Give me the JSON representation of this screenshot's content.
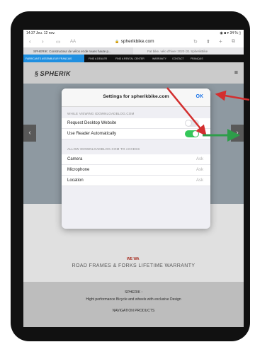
{
  "status": {
    "time": "14:37  Jeu. 12 nov.",
    "indicators": "◉ ■ ▾ 34 % ▯"
  },
  "urlbar": {
    "back": "‹",
    "forward": "›",
    "book": "▭",
    "aa": "AA",
    "domain": "spherikbike.com",
    "reload": "↻",
    "share": "⬆",
    "add": "+",
    "tabs": "⧉"
  },
  "tabs": [
    {
      "label": "SPHERIK: Constructeur de vélos et de roues haute p..."
    },
    {
      "label": "Fat bike, vélo d'hiver 2020 /21 SpherikBike"
    }
  ],
  "nav": [
    "FABRICANTS ASSEMBLEUR FRANCAIS",
    "FIND A DEALER",
    "FIND A RENTAL CENTER",
    "WARRANTY",
    "CONTACT",
    "FRANÇAIS"
  ],
  "site": {
    "logo": "SPHERIK",
    "logo_symbol": "§",
    "menu_icon": "≡"
  },
  "hero": {
    "left_arrow": "‹",
    "right_arrow": "›"
  },
  "content": {
    "badge": "WE WA",
    "warranty": "ROAD FRAMES & FORKS LIFETIME WARRANTY",
    "line1": "SPHERIK :",
    "line2": "Hight performance Bicycle and wheels with exclusive Design",
    "line3": "NAVIGATION PRODUCTS"
  },
  "popover": {
    "title": "Settings for spherikbike.com",
    "ok": "OK",
    "section1": "WHILE VIEWING IDOWNLOADBLOG.COM",
    "request_desktop": "Request Desktop Website",
    "use_reader": "Use Reader Automatically",
    "section2": "ALLOW IDOWNLOADBLOG.COM TO ACCESS",
    "perms": [
      {
        "label": "Camera",
        "value": "Ask"
      },
      {
        "label": "Microphone",
        "value": "Ask"
      },
      {
        "label": "Location",
        "value": "Ask"
      }
    ],
    "request_desktop_on": false,
    "use_reader_on": true
  },
  "colors": {
    "accent": "#1a73e8",
    "toggle_on": "#34c759",
    "arrow_red": "#d32f2f",
    "arrow_green": "#2e9d4a"
  }
}
